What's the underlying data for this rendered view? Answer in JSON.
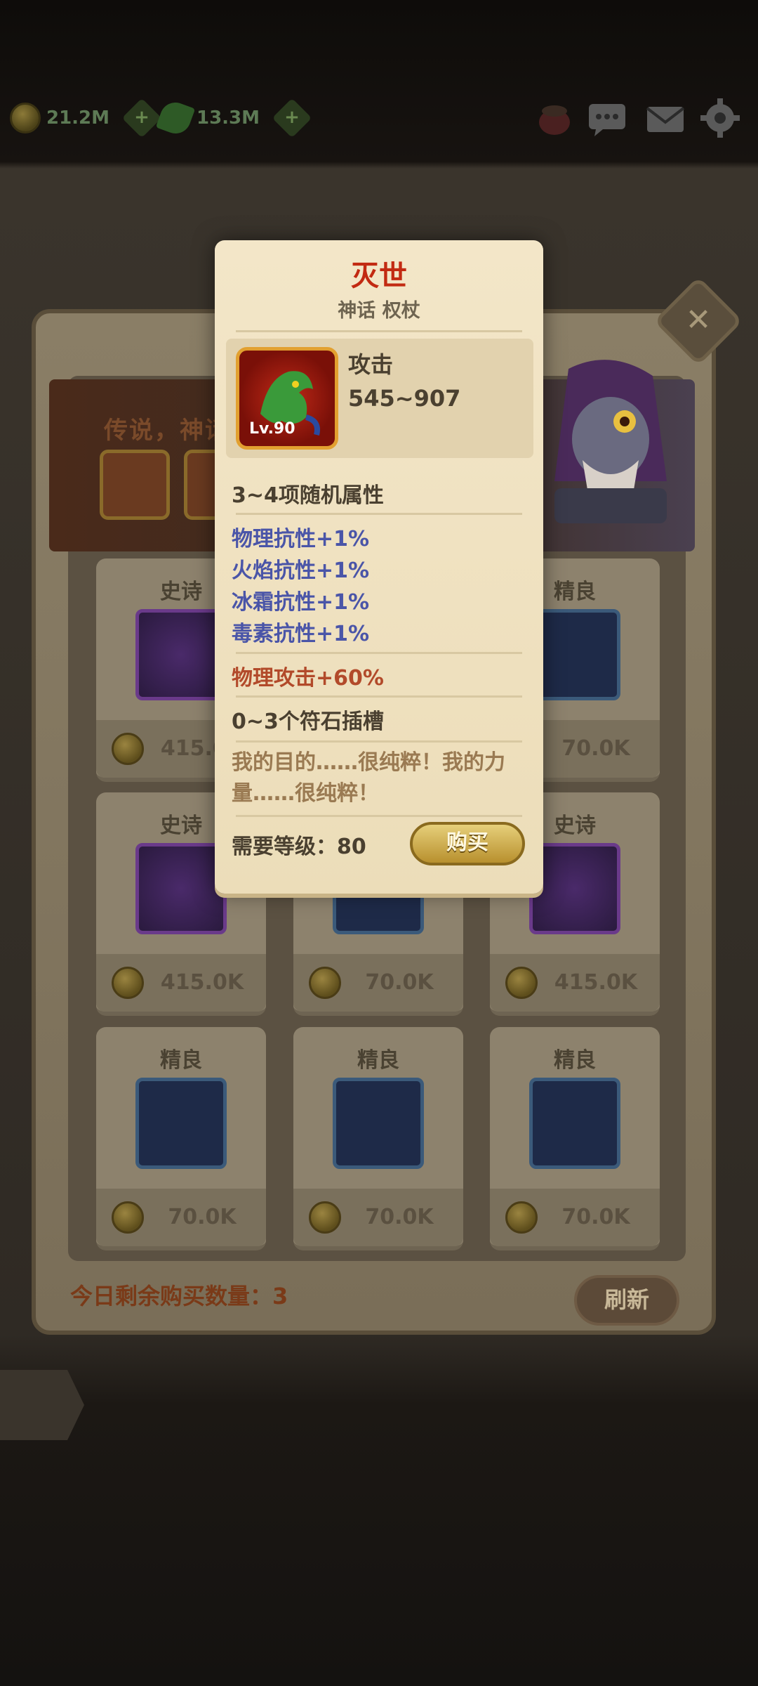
{
  "hud": {
    "gold": "21.2M",
    "herb": "13.3M"
  },
  "shop": {
    "banner_text": "传说，神话",
    "daily_remaining": "今日剩余购买数量：3",
    "refresh_label": "刷新",
    "items": [
      {
        "rarity": "史诗",
        "price": "415.0K",
        "tier": "epic"
      },
      {
        "rarity": "",
        "price": "",
        "tier": "blue"
      },
      {
        "rarity": "精良",
        "price": "70.0K",
        "tier": "blue"
      },
      {
        "rarity": "史诗",
        "price": "415.0K",
        "tier": "epic"
      },
      {
        "rarity": "",
        "price": "70.0K",
        "tier": "blue"
      },
      {
        "rarity": "史诗",
        "price": "415.0K",
        "tier": "epic"
      },
      {
        "rarity": "精良",
        "price": "70.0K",
        "tier": "blue"
      },
      {
        "rarity": "精良",
        "price": "70.0K",
        "tier": "blue"
      },
      {
        "rarity": "精良",
        "price": "70.0K",
        "tier": "blue"
      }
    ]
  },
  "tooltip": {
    "name": "灭世",
    "subtitle": "神话 权杖",
    "level_badge": "Lv.90",
    "stat_label": "攻击",
    "stat_value": "545~907",
    "random_attr_header": "3~4项随机属性",
    "random_attrs": [
      "物理抗性+1%",
      "火焰抗性+1%",
      "冰霜抗性+1%",
      "毒素抗性+1%"
    ],
    "fixed_attr": "物理攻击+60%",
    "rune_slots": "0~3个符石插槽",
    "lore_line1": "我的目的……很纯粹！我的力",
    "lore_line2": "量……很纯粹！",
    "required_level": "需要等级：80",
    "buy_label": "购买"
  },
  "colors": {
    "title_red": "#c22a12",
    "attr_blue": "#4a55a8",
    "attr_red": "#b24a2a"
  }
}
